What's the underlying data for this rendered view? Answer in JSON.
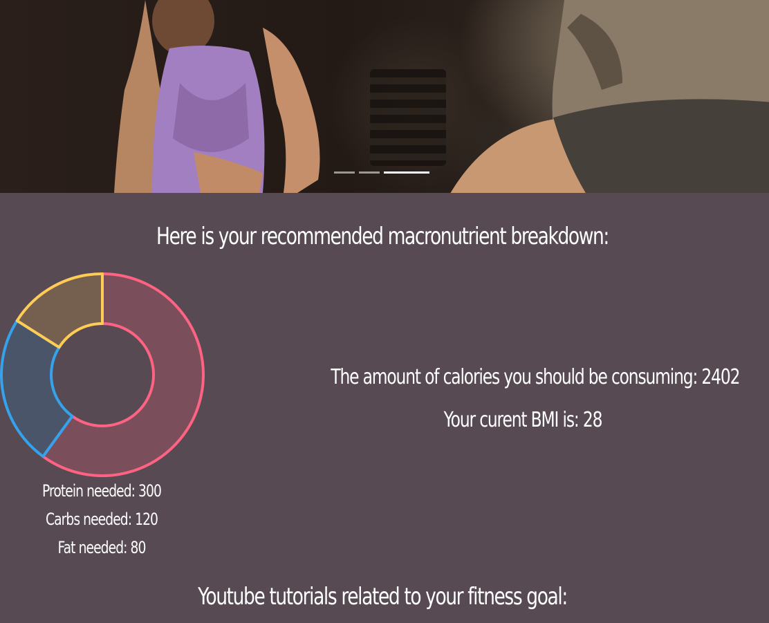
{
  "hero": {
    "slides": 3,
    "active_slide": 3
  },
  "macro_section": {
    "title": "Here is your recommended macronutrient breakdown:"
  },
  "chart_data": {
    "type": "pie",
    "variant": "doughnut",
    "categories": [
      "Protein",
      "Carbs",
      "Fat"
    ],
    "values": [
      300,
      120,
      80
    ],
    "colors": [
      "#ff6384",
      "#36a2eb",
      "#ffcd56"
    ],
    "fill_colors": [
      "#7a4e5a",
      "#4b5569",
      "#756050"
    ]
  },
  "macros": {
    "protein": "Protein needed: 300",
    "carbs": "Carbs needed: 120",
    "fat": "Fat needed: 80"
  },
  "stats": {
    "calories": "The amount of calories you should be consuming: 2402",
    "bmi": "Your curent BMI is: 28"
  },
  "youtube_section": {
    "title": "Youtube tutorials related to your fitness goal:"
  }
}
